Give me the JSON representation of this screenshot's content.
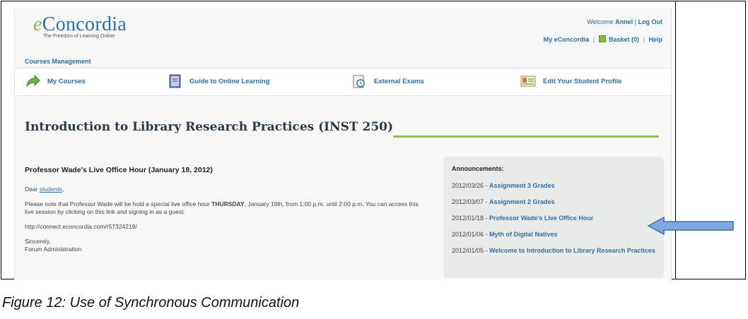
{
  "header": {
    "logo_text": "Concordia",
    "logo_prefix": "e",
    "logo_tagline": "The Freedom of Learning Online",
    "welcome_prefix": "Welcome",
    "user_name": "Annel",
    "logout_label": "Log Out",
    "my_econcordia_label": "My eConcordia",
    "basket_label": "Basket (0)",
    "help_label": "Help"
  },
  "courses_management_label": "Courses Management",
  "nav": [
    {
      "label": "My Courses"
    },
    {
      "label": "Guide to Online Learning"
    },
    {
      "label": "External Exams"
    },
    {
      "label": "Edit Your Student Profile"
    }
  ],
  "course_title": "Introduction to Library Research Practices (INST 250)",
  "post": {
    "title": "Professor Wade's Live Office Hour (January 18, 2012)",
    "greeting_prefix": "Dear",
    "greeting_link": "students",
    "body_part1": "Please note that Professor Wade will be hold a special live office hour",
    "body_bold": "THURSDAY",
    "body_part2": ", January 19th, from 1:00 p.m. until 2:00 p.m.  You can access this live session by clicking on this link and signing in as a guest.",
    "url": "http://connect.econcordia.com/r57324219/",
    "signoff": "Sincerely,",
    "signature": "Forum Administration"
  },
  "announcements": {
    "heading": "Announcements:",
    "items": [
      {
        "date": "2012/03/26",
        "title": "Assignment 3 Grades"
      },
      {
        "date": "2012/03/07",
        "title": "Assignment 2 Grades"
      },
      {
        "date": "2012/01/18",
        "title": "Professor Wade's Live Office Hour"
      },
      {
        "date": "2012/01/06",
        "title": "Myth of Digital Natives"
      },
      {
        "date": "2012/01/05",
        "title": "Welcome to Introduction to Library Research Practices"
      }
    ]
  },
  "caption": "Figure 12: Use of Synchronous Communication",
  "colors": {
    "brand_blue": "#2e6fa7",
    "brand_green": "#8bc34a",
    "arrow_blue": "#6f9ed8"
  }
}
